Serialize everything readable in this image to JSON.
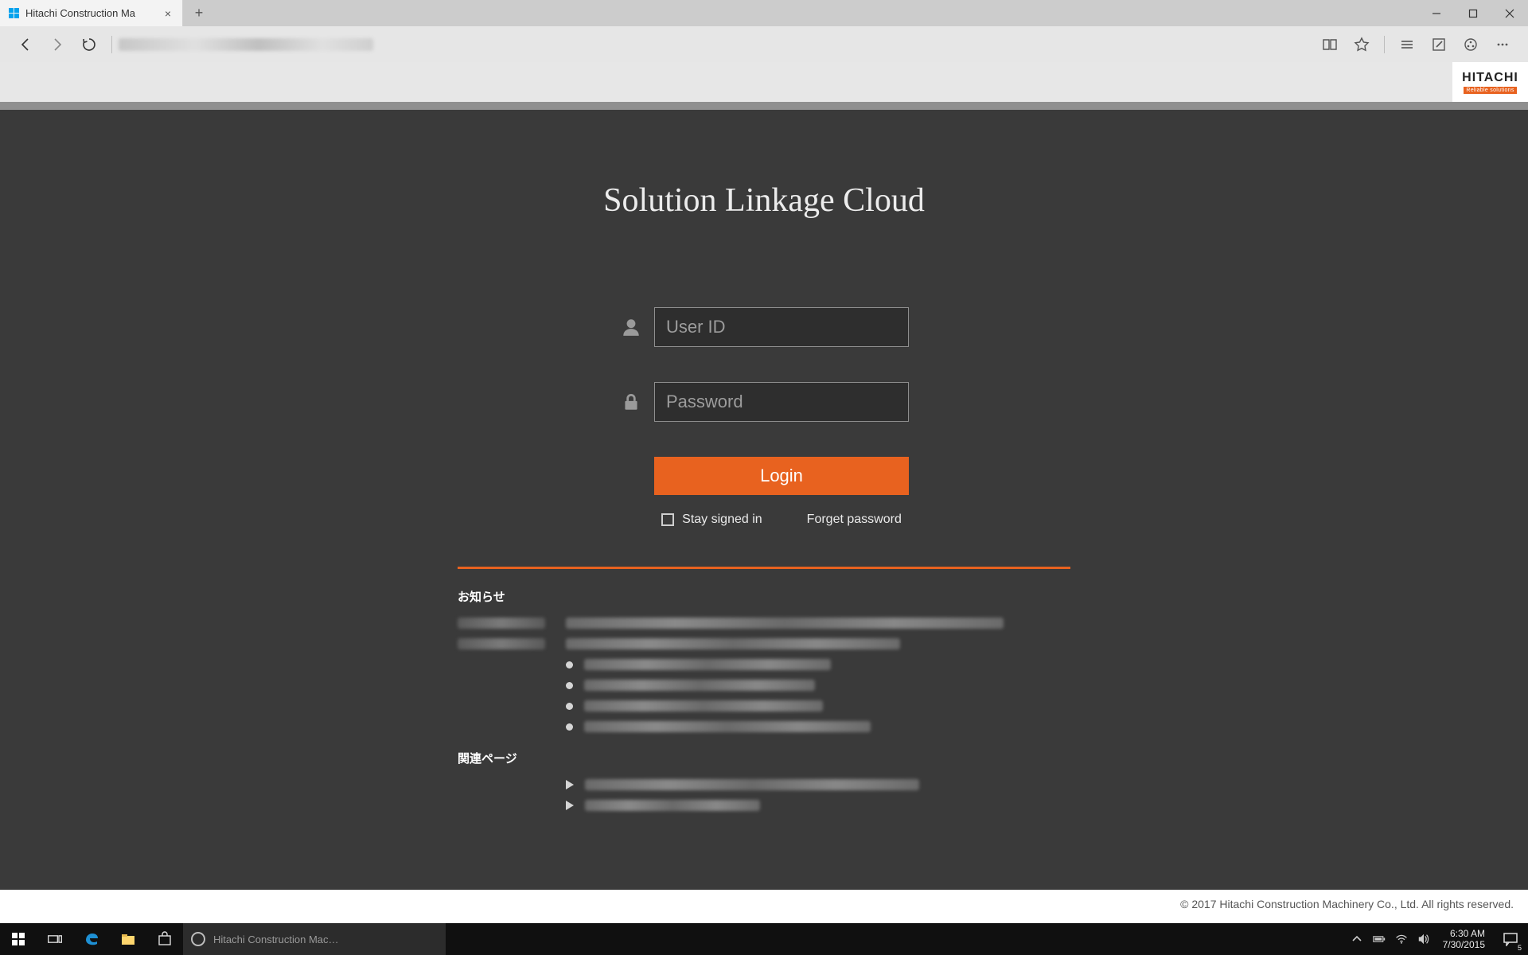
{
  "browser": {
    "tab_title": "Hitachi Construction Ma",
    "minimize_tip": "Minimize",
    "maximize_tip": "Maximize",
    "close_tip": "Close"
  },
  "brand": {
    "name": "HITACHI",
    "tagline": "Reliable solutions"
  },
  "login": {
    "app_title": "Solution Linkage Cloud",
    "user_placeholder": "User ID",
    "password_placeholder": "Password",
    "login_label": "Login",
    "stay_signed_label": "Stay signed in",
    "forget_label": "Forget password"
  },
  "sections": {
    "news_title": "お知らせ",
    "related_title": "関連ページ"
  },
  "footer": {
    "copyright": "© 2017 Hitachi Construction Machinery Co., Ltd. All rights reserved."
  },
  "taskbar": {
    "search_placeholder": "Hitachi Construction Mac…",
    "time": "6:30 AM",
    "date": "7/30/2015",
    "notif_count": "5"
  }
}
